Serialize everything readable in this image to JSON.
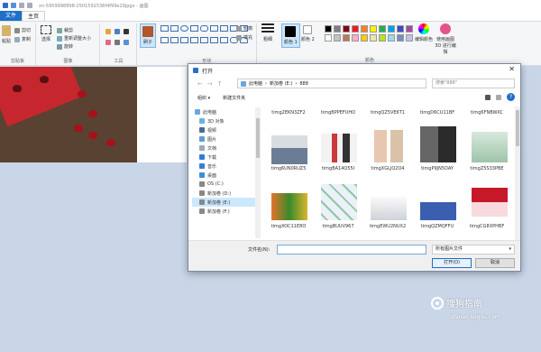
{
  "app": {
    "title": "xn-5959998898-2501591536f4f99e29jpgx - 画图"
  },
  "tabs": [
    {
      "label": "文件"
    },
    {
      "label": "主页"
    }
  ],
  "ribbon": {
    "clipboard": {
      "paste": "粘贴",
      "cut": "剪切",
      "copy": "复制",
      "label": "剪贴板"
    },
    "image": {
      "select": "选择",
      "crop": "裁剪",
      "resize": "重新调整大小",
      "rotate": "旋转",
      "label": "图像"
    },
    "tools": {
      "label": "工具"
    },
    "brush": {
      "label": "刷子"
    },
    "shapes": {
      "outline": "轮廓",
      "fill": "填充",
      "label": "形状"
    },
    "size": {
      "label": "粗细"
    },
    "color1": {
      "label": "颜色 1"
    },
    "color2": {
      "label": "颜色 2"
    },
    "colors": {
      "label": "颜色"
    },
    "edit_colors": {
      "label": "编辑颜色"
    },
    "paint3d": {
      "label": "使用画图 3D 进行编辑"
    },
    "swatches": [
      "#000000",
      "#7f7f7f",
      "#880015",
      "#ed1c24",
      "#ff7f27",
      "#fff200",
      "#22b14c",
      "#00a2e8",
      "#3f48cc",
      "#a349a4",
      "#ffffff",
      "#c3c3c3",
      "#b97a57",
      "#ffaec9",
      "#ffc90e",
      "#efe4b0",
      "#b5e61d",
      "#99d9ea",
      "#7092be",
      "#c8bfe7"
    ]
  },
  "dialog": {
    "title": "打开",
    "path": [
      "此电脑",
      "新加卷 (E:)",
      "888"
    ],
    "search_placeholder": "搜索\"888\"",
    "organize": "组织 ▾",
    "new_folder": "新建文件夹",
    "sidebar": [
      {
        "label": "此电脑",
        "level": "top"
      },
      {
        "label": "3D 对象",
        "level": "sub"
      },
      {
        "label": "视频",
        "level": "sub"
      },
      {
        "label": "图片",
        "level": "sub"
      },
      {
        "label": "文档",
        "level": "sub"
      },
      {
        "label": "下载",
        "level": "sub"
      },
      {
        "label": "音乐",
        "level": "sub"
      },
      {
        "label": "桌面",
        "level": "sub"
      },
      {
        "label": "OS (C:)",
        "level": "sub"
      },
      {
        "label": "新加卷 (D:)",
        "level": "sub"
      },
      {
        "label": "新加卷 (E:)",
        "level": "sub",
        "selected": true
      },
      {
        "label": "新加卷 (F:)",
        "level": "sub"
      }
    ],
    "partial_row": [
      "timg2EKN3ZF2",
      "timgBPPEFUHO",
      "timgQZ5VE6T1",
      "timgD6CU11BF",
      "timg6FNBWXC"
    ],
    "files_row1": [
      "timg6UN0RUZ5",
      "timgBA14O55I",
      "timgXGLJQ2O4",
      "timgP9JN5DAY",
      "timgZ5S33PBE"
    ],
    "files_row2": [
      "timgXOC11E8O",
      "timgBUUV967",
      "timgEWU2NUX2",
      "timgQZMQFFU",
      "timgCG8XPHBF"
    ],
    "filename_label": "文件名(N):",
    "filetype": "所有图片文件",
    "open_button": "打开(O)",
    "cancel_button": "取消"
  },
  "watermark": {
    "text": "搜狗指南",
    "url": "shinan.sogou.com"
  }
}
